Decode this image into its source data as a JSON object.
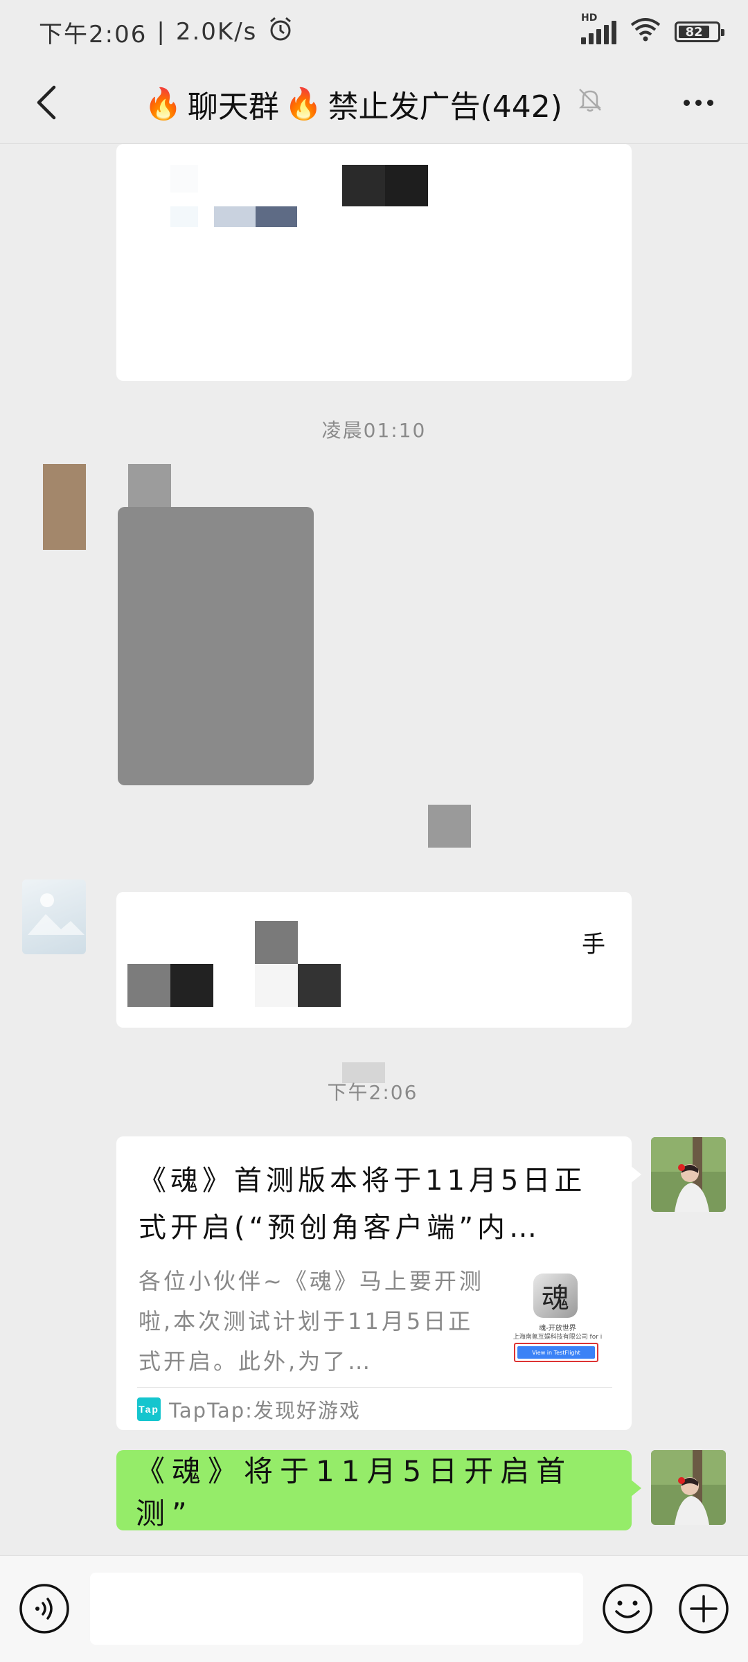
{
  "status_bar": {
    "time": "下午2:06",
    "separator": "|",
    "speed": "2.0K/s",
    "hd": "HD",
    "battery": "82"
  },
  "header": {
    "title_prefix": "🔥",
    "title_name": "聊天群",
    "title_mid": "🔥",
    "title_suffix": "禁止发广告(442)"
  },
  "messages": {
    "time_1": "凌晨01:10",
    "partial_char": "手",
    "time_2": "下午2:06",
    "card": {
      "title": "《魂》首测版本将于11月5日正式开启(“预创角客户端”内…",
      "description": "各位小伙伴~《魂》马上要开测啦,本次测试计划于11月5日正式开启。此外,为了…",
      "thumb_char": "魂",
      "thumb_line1": "魂-开放世界",
      "thumb_line2": "上海南氪互娱科技有限公司 for i",
      "thumb_button": "View in TestFlight",
      "source_logo": "Tap",
      "source": "TapTap:发现好游戏"
    },
    "text_message": "《魂》将于11月5日开启首测”"
  },
  "colors": {
    "background": "#ededed",
    "green_bubble": "#95ec69",
    "taptap": "#15c5ce"
  },
  "icons": [
    "back-arrow-icon",
    "mute-bell-icon",
    "more-icon",
    "alarm-icon",
    "signal-icon",
    "wifi-icon",
    "battery-icon",
    "voice-icon",
    "emoji-icon",
    "plus-icon"
  ]
}
